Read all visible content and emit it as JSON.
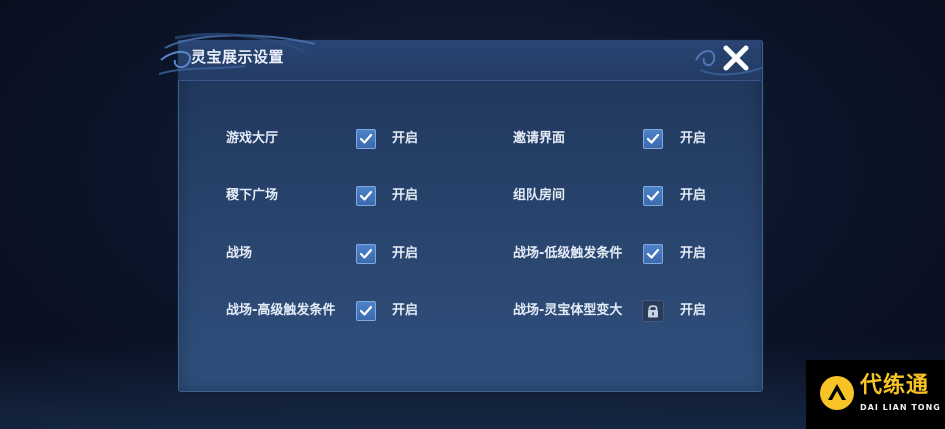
{
  "dialog": {
    "title": "灵宝展示设置",
    "close_label": "close"
  },
  "settings": [
    {
      "label": "游戏大厅",
      "checked": true,
      "locked": false,
      "state": "开启"
    },
    {
      "label": "邀请界面",
      "checked": true,
      "locked": false,
      "state": "开启"
    },
    {
      "label": "稷下广场",
      "checked": true,
      "locked": false,
      "state": "开启"
    },
    {
      "label": "组队房间",
      "checked": true,
      "locked": false,
      "state": "开启"
    },
    {
      "label": "战场",
      "checked": true,
      "locked": false,
      "state": "开启"
    },
    {
      "label": "战场-低级触发条件",
      "checked": true,
      "locked": false,
      "state": "开启"
    },
    {
      "label": "战场-高级触发条件",
      "checked": true,
      "locked": false,
      "state": "开启"
    },
    {
      "label": "战场-灵宝体型变大",
      "checked": false,
      "locked": true,
      "state": "开启"
    }
  ],
  "watermark": {
    "name_cn": "代练通",
    "name_en": "DAI LIAN TONG"
  },
  "colors": {
    "accent": "#f7c325",
    "checkbox": "#4579bd",
    "panel": "#29456e"
  }
}
